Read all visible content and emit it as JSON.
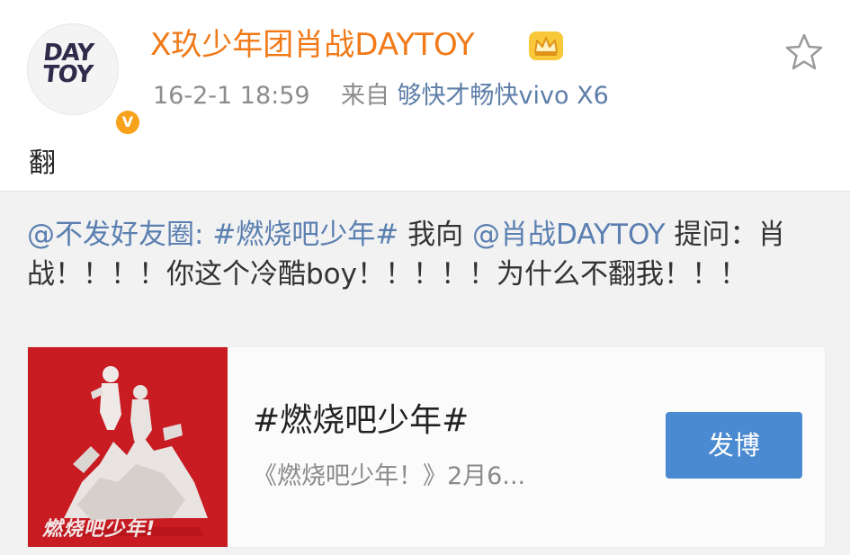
{
  "post": {
    "avatar_text_line1": "DAY",
    "avatar_text_line2": "TOY",
    "verified_badge": "V",
    "username": "X玖少年团肖战DAYTOY",
    "time": "16-2-1 18:59",
    "source_prefix": "来自",
    "source": "够快才畅快vivo X6",
    "text": "翻",
    "icons": [
      "crown-icon",
      "star-icon",
      "verified-badge-icon"
    ]
  },
  "repost": {
    "mention_user": "@不发好友圈:",
    "topic": "#燃烧吧少年#",
    "text1": " 我向 ",
    "mention_target": "@肖战DAYTOY",
    "text2": " 提问：肖战！！！！你这个冷酷boy！！！！！为什么不翻我！！！"
  },
  "card": {
    "thumb_caption": "燃烧吧少年!",
    "title": "#燃烧吧少年#",
    "subtitle": "《燃烧吧少年！》2月6...",
    "button_label": "发博"
  },
  "colors": {
    "username": "#f07a18",
    "link_blue": "#5a7fb0",
    "button_bg": "#4a8ad0",
    "thumb_bg": "#c81b22"
  }
}
